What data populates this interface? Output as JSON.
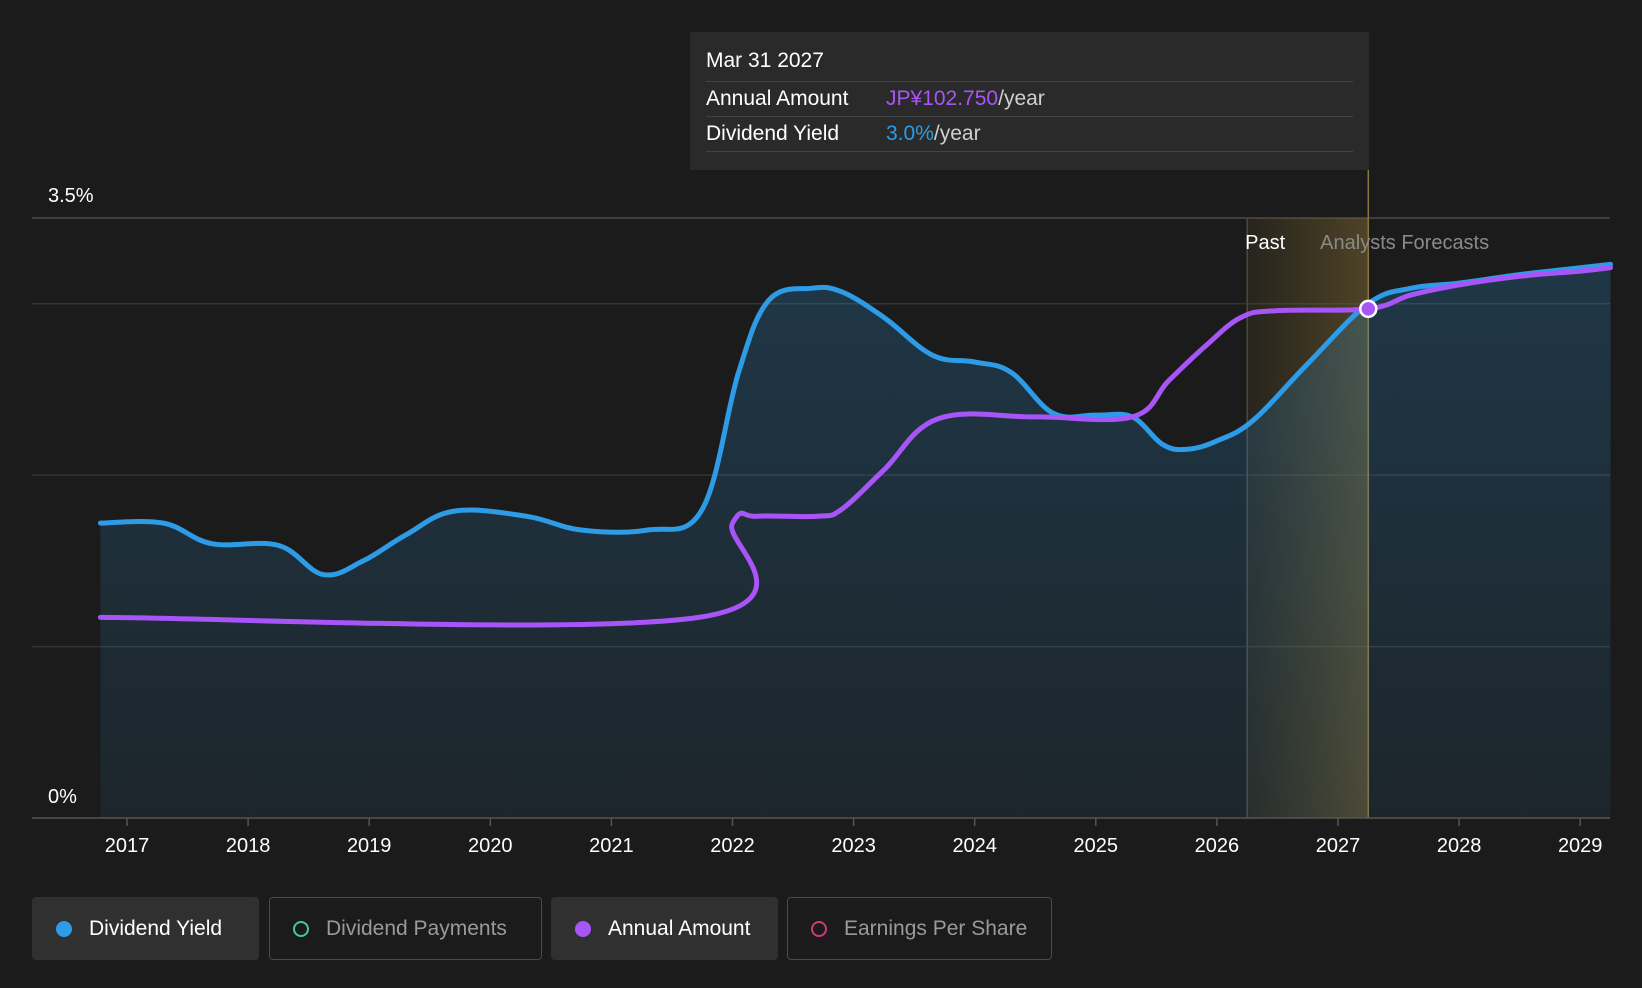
{
  "chart_data": {
    "type": "area",
    "y_axis": {
      "ticks": [
        {
          "label": "3.5%",
          "value": 3.5
        },
        {
          "label": "0%",
          "value": 0
        }
      ],
      "ylim": [
        0,
        3.5
      ]
    },
    "x_axis": {
      "ticks": [
        "2017",
        "2018",
        "2019",
        "2020",
        "2021",
        "2022",
        "2023",
        "2024",
        "2025",
        "2026",
        "2027",
        "2028",
        "2029"
      ],
      "xlim": [
        2016.74,
        2029.25
      ]
    },
    "grid": true,
    "regions": {
      "past_label": "Past",
      "forecast_label": "Analysts Forecasts",
      "past_end": 2026.25,
      "highlight_end": 2027.25
    },
    "series": [
      {
        "name": "Dividend Yield",
        "color": "#2e9be6",
        "area": true,
        "x": [
          2016.78,
          2017.3,
          2017.7,
          2018.25,
          2018.62,
          2018.95,
          2019.3,
          2019.7,
          2020.3,
          2020.75,
          2021.3,
          2021.75,
          2022.05,
          2022.3,
          2022.65,
          2022.9,
          2023.25,
          2023.65,
          2024.0,
          2024.3,
          2024.65,
          2025.0,
          2025.3,
          2025.55,
          2025.75,
          2026.0,
          2026.3,
          2026.75,
          2027.25,
          2027.6,
          2028.0,
          2028.5,
          2029.0,
          2029.25
        ],
        "values": [
          1.72,
          1.72,
          1.6,
          1.59,
          1.42,
          1.5,
          1.65,
          1.79,
          1.76,
          1.68,
          1.68,
          1.8,
          2.6,
          3.02,
          3.09,
          3.07,
          2.92,
          2.7,
          2.66,
          2.6,
          2.36,
          2.35,
          2.34,
          2.18,
          2.15,
          2.2,
          2.32,
          2.65,
          3.0,
          3.09,
          3.12,
          3.17,
          3.21,
          3.23
        ]
      },
      {
        "name": "Annual Amount",
        "color": "#a855f7",
        "area": false,
        "x": [
          2016.78,
          2021.72,
          2022.0,
          2022.2,
          2022.7,
          2022.9,
          2023.25,
          2023.7,
          2024.5,
          2025.3,
          2025.6,
          2025.9,
          2026.2,
          2026.5,
          2027.25,
          2027.6,
          2028.0,
          2028.5,
          2029.0,
          2029.25
        ],
        "values": [
          1.17,
          1.17,
          1.72,
          1.76,
          1.76,
          1.8,
          2.03,
          2.33,
          2.34,
          2.34,
          2.55,
          2.75,
          2.92,
          2.96,
          2.97,
          3.05,
          3.11,
          3.16,
          3.19,
          3.21
        ]
      }
    ],
    "highlight_point": {
      "x": 2027.25,
      "y": 2.97
    }
  },
  "tooltip": {
    "date": "Mar 31 2027",
    "annual_amount_label": "Annual Amount",
    "annual_amount_value": "JP¥102.750",
    "annual_amount_unit": "/year",
    "dividend_yield_label": "Dividend Yield",
    "dividend_yield_value": "3.0%",
    "dividend_yield_unit": "/year"
  },
  "legend": [
    {
      "label": "Dividend Yield",
      "color": "#2e9be6",
      "active": true,
      "filled": true
    },
    {
      "label": "Dividend Payments",
      "color": "#3fc9a8",
      "active": false,
      "filled": false
    },
    {
      "label": "Annual Amount",
      "color": "#a855f7",
      "active": true,
      "filled": true
    },
    {
      "label": "Earnings Per Share",
      "color": "#d03a7a",
      "active": false,
      "filled": false
    }
  ]
}
